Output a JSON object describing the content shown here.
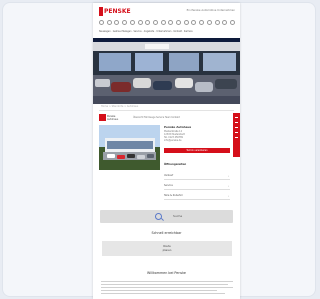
{
  "header": {
    "logo_text": "PENSKE",
    "top_right": "Ein Penske Automotive Unternehmen",
    "nav_text": "Neuwagen · Gebrauchtwagen · Service · Angebote · Unternehmen · Kontakt · Karriere"
  },
  "breadcrumb": "Home > Standorte > Autohaus",
  "sub": {
    "brand_line1": "Penske",
    "brand_line2": "Autohaus",
    "tabs": "Übersicht   Fahrzeuge   Service   Team   Kontakt"
  },
  "location": {
    "heading": "Penske Autohaus",
    "lines": [
      "Musterstraße 12",
      "12345 Musterstadt",
      "Tel. 0123 456789",
      "info@penske.de"
    ],
    "cta": "Termin vereinbaren"
  },
  "hours": {
    "title": "Öffnungszeiten",
    "items": [
      "Verkauf",
      "Service",
      "Teile & Zubehör"
    ]
  },
  "search": {
    "label": "Suche"
  },
  "detail": {
    "heading": "Schnell erreichbar",
    "btn_line1": "Route",
    "btn_line2": "planen"
  },
  "welcome": {
    "heading": "Willkommen bei Penske"
  },
  "colors": {
    "brand_red": "#d50f1a"
  }
}
